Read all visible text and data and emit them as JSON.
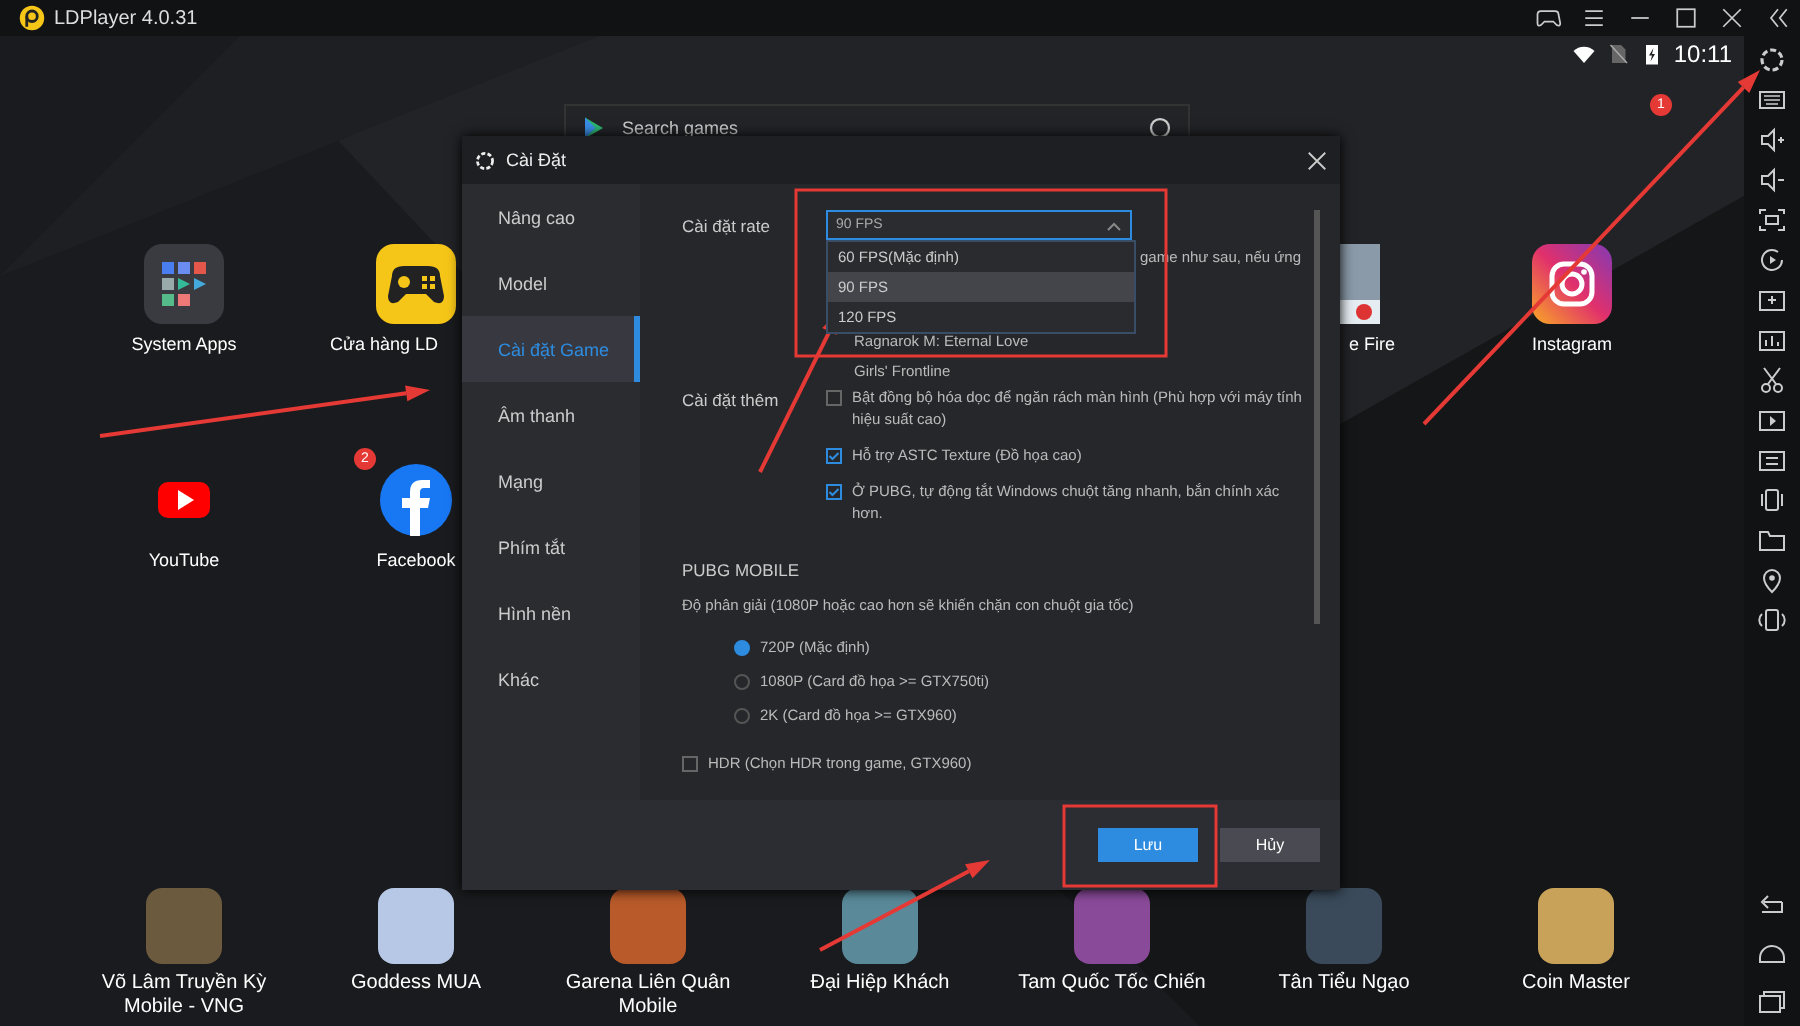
{
  "app_title": "LDPlayer 4.0.31",
  "status_bar": {
    "time": "10:11"
  },
  "search": {
    "placeholder": "Search games"
  },
  "notification_badge": "1",
  "desktop_icons": [
    {
      "label": "System Apps",
      "kind": "full"
    },
    {
      "label": "Cửa hàng LD",
      "kind": "full"
    },
    {
      "label": "e Fire",
      "kind": "clipped"
    },
    {
      "label": "Instagram",
      "kind": "full"
    },
    {
      "label": "YouTube",
      "kind": "full"
    },
    {
      "label": "Facebook",
      "kind": "full",
      "badge": "2"
    }
  ],
  "dock": [
    "Võ Lâm Truyền Kỳ Mobile - VNG",
    "Goddess MUA",
    "Garena Liên Quân Mobile",
    "Đại Hiệp Khách",
    "Tam Quốc Tốc Chiến",
    "Tân Tiểu Ngạo",
    "Coin Master"
  ],
  "dialog": {
    "title": "Cài Đặt",
    "nav": [
      {
        "label": "Nâng cao",
        "selected": false
      },
      {
        "label": "Model",
        "selected": false
      },
      {
        "label": "Cài đặt Game",
        "selected": true
      },
      {
        "label": "Âm thanh",
        "selected": false
      },
      {
        "label": "Mạng",
        "selected": false
      },
      {
        "label": "Phím tắt",
        "selected": false
      },
      {
        "label": "Hình nền",
        "selected": false
      },
      {
        "label": "Khác",
        "selected": false
      }
    ],
    "rate_label": "Cài đặt rate",
    "rate_select": {
      "value": "90 FPS",
      "expanded": true,
      "options": [
        {
          "label": "60  FPS(Mặc định)",
          "selected": false
        },
        {
          "label": "90 FPS",
          "selected": true
        },
        {
          "label": "120 FPS",
          "selected": false
        }
      ]
    },
    "covered_text": "game như sau, nếu ứng",
    "games": [
      "Ragnarok M: Eternal Love",
      "Girls' Frontline"
    ],
    "extra_label": "Cài đặt thêm",
    "checks": [
      {
        "label": "Bật đồng bộ hóa dọc để ngăn rách màn hình  (Phù hợp với máy tính hiệu suất cao)",
        "checked": false
      },
      {
        "label": "Hỗ trợ ASTC Texture  (Đồ họa cao)",
        "checked": true
      },
      {
        "label": "Ở PUBG, tự động tắt Windows chuột tăng nhanh, bắn chính xác hơn.",
        "checked": true
      }
    ],
    "pubg_title": "PUBG MOBILE",
    "resolution_label": "Độ phân giải  (1080P hoặc cao hơn sẽ khiến chặn con chuột gia tốc)",
    "resolutions": [
      {
        "label": "720P (Mặc định)",
        "selected": true
      },
      {
        "label": "1080P (Card đồ họa >= GTX750ti)",
        "selected": false
      },
      {
        "label": "2K (Card đồ họa >= GTX960)",
        "selected": false
      }
    ],
    "hdr": {
      "label": "HDR (Chọn HDR trong game, GTX960)",
      "checked": false
    },
    "save": "Lưu",
    "cancel": "Hủy"
  }
}
